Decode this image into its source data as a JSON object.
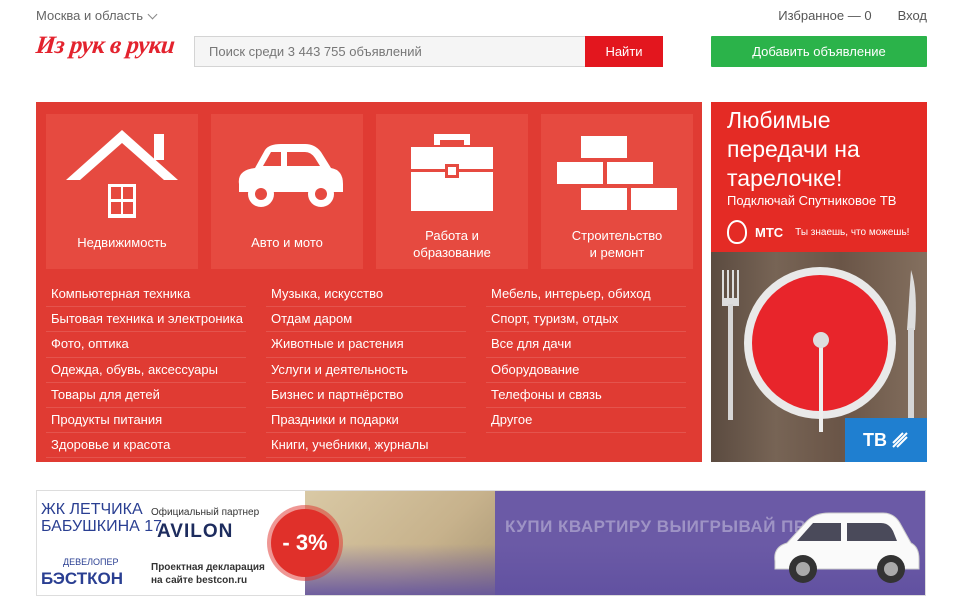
{
  "top": {
    "region": "Москва и область",
    "favorites": "Избранное — 0",
    "login": "Вход"
  },
  "header": {
    "logo": "Из рук в руки",
    "search_placeholder": "Поиск среди 3 443 755 объявлений",
    "search_button": "Найти",
    "add_button": "Добавить объявление"
  },
  "categories": {
    "tiles": [
      {
        "label": "Недвижимость",
        "icon": "house-icon"
      },
      {
        "label": "Авто и мото",
        "icon": "car-icon"
      },
      {
        "label": "Работа и\nобразование",
        "icon": "briefcase-icon"
      },
      {
        "label": "Строительство\nи ремонт",
        "icon": "bricks-icon"
      }
    ],
    "columns": [
      [
        "Компьютерная техника",
        "Бытовая техника и электроника",
        "Фото, оптика",
        "Одежда, обувь, аксессуары",
        "Товары для детей",
        "Продукты питания",
        "Здоровье и красота"
      ],
      [
        "Музыка, искусство",
        "Отдам даром",
        "Животные и растения",
        "Услуги и деятельность",
        "Бизнес и партнёрство",
        "Праздники и подарки",
        "Книги, учебники, журналы"
      ],
      [
        "Мебель, интерьер, обиход",
        "Спорт, туризм, отдых",
        "Все для дачи",
        "Оборудование",
        "Телефоны и связь",
        "Другое"
      ]
    ]
  },
  "side_ad": {
    "headline": "Любимые передачи на тарелочке!",
    "subline": "Подключай Спутниковое ТВ",
    "brand": "МТС",
    "slogan": "Ты знаешь, что можешь!",
    "tv_badge": "ТВ"
  },
  "banner": {
    "jk_top": "ЖК ЛЕТЧИКА",
    "jk_bottom": "БАБУШКИНА 17",
    "partner": "Официальный партнер",
    "avilon": "AVILON",
    "developer": "ДЕВЕЛОПЕР",
    "bestcon": "БЭСТКОН",
    "declaration_1": "Проектная декларация",
    "declaration_2": "на сайте bestcon.ru",
    "discount": "- 3%",
    "slogan": "КУПИ КВАРТИРУ ВЫИГРЫВАЙ ПРИЗЫ"
  },
  "colors": {
    "brand_red": "#e3161e",
    "panel_red": "#e03b33",
    "green": "#2bb34a",
    "mts_blue": "#1f7fd0"
  }
}
